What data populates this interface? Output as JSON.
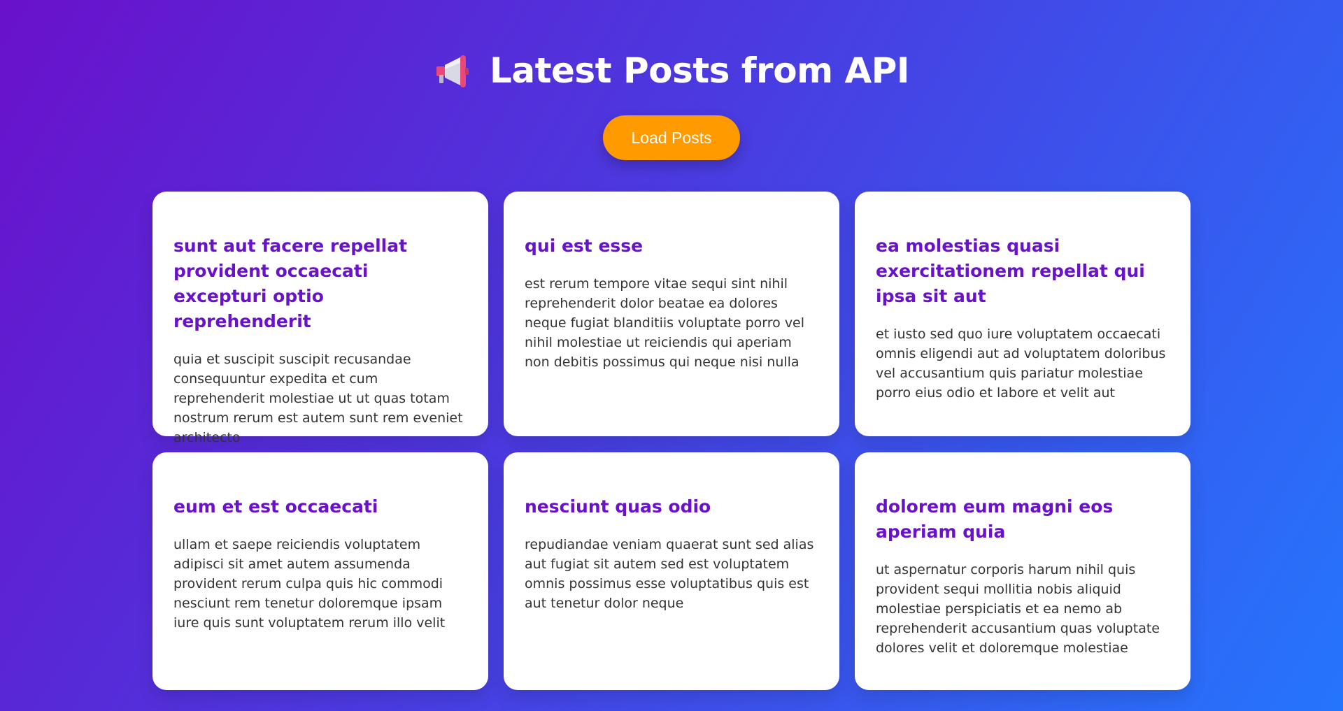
{
  "header": {
    "icon": "megaphone-icon",
    "title": "Latest Posts from API"
  },
  "load_button": {
    "label": "Load Posts",
    "color": "#ff9a00"
  },
  "colors": {
    "gradient_start": "#6a11cb",
    "gradient_end": "#2575fc",
    "card_title": "#6a11cb",
    "card_body": "#333333"
  },
  "posts": [
    {
      "title": "sunt aut facere repellat provident occaecati excepturi optio reprehenderit",
      "body": "quia et suscipit suscipit recusandae consequuntur expedita et cum reprehenderit molestiae ut ut quas totam nostrum rerum est autem sunt rem eveniet architecto"
    },
    {
      "title": "qui est esse",
      "body": "est rerum tempore vitae sequi sint nihil reprehenderit dolor beatae ea dolores neque fugiat blanditiis voluptate porro vel nihil molestiae ut reiciendis qui aperiam non debitis possimus qui neque nisi nulla"
    },
    {
      "title": "ea molestias quasi exercitationem repellat qui ipsa sit aut",
      "body": "et iusto sed quo iure voluptatem occaecati omnis eligendi aut ad voluptatem doloribus vel accusantium quis pariatur molestiae porro eius odio et labore et velit aut"
    },
    {
      "title": "eum et est occaecati",
      "body": "ullam et saepe reiciendis voluptatem adipisci sit amet autem assumenda provident rerum culpa quis hic commodi nesciunt rem tenetur doloremque ipsam iure quis sunt voluptatem rerum illo velit"
    },
    {
      "title": "nesciunt quas odio",
      "body": "repudiandae veniam quaerat sunt sed alias aut fugiat sit autem sed est voluptatem omnis possimus esse voluptatibus quis est aut tenetur dolor neque"
    },
    {
      "title": "dolorem eum magni eos aperiam quia",
      "body": "ut aspernatur corporis harum nihil quis provident sequi mollitia nobis aliquid molestiae perspiciatis et ea nemo ab reprehenderit accusantium quas voluptate dolores velit et doloremque molestiae"
    }
  ]
}
